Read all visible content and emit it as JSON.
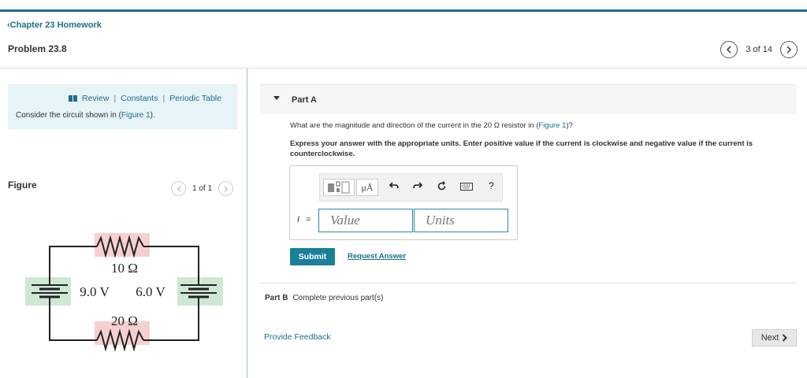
{
  "header": {
    "back_label": "Chapter 23 Homework",
    "back_chevron": "‹",
    "problem_title": "Problem 23.8",
    "pager_text": "3 of 14",
    "prev_icon": "chevron-left-icon",
    "next_icon": "chevron-right-icon"
  },
  "sidebar": {
    "links": [
      "Review",
      "Constants",
      "Periodic Table"
    ],
    "separator": "|",
    "consider_prefix": "Consider the circuit shown in (",
    "consider_link": "Figure 1",
    "consider_suffix": ").",
    "figure_label": "Figure",
    "figure_pager": "1 of 1"
  },
  "circuit": {
    "r_top": "10 Ω",
    "r_bottom": "20 Ω",
    "v_left": "9.0 V",
    "v_right": "6.0 V"
  },
  "part_a": {
    "label": "Part A",
    "question_prefix": "What are the magnitude and direction of the current in the 20 Ω resistor in (",
    "question_link": "Figure 1",
    "question_suffix": ")?",
    "instructions": "Express your answer with the appropriate units. Enter positive value if the current is clockwise and negative value if the current is counterclockwise.",
    "variable": "I",
    "equals": "=",
    "value_placeholder": "Value",
    "units_placeholder": "Units",
    "toolbar": {
      "units_button": "μÅ",
      "help": "?"
    },
    "submit_label": "Submit",
    "request_answer_label": "Request Answer"
  },
  "part_b": {
    "label": "Part B",
    "status": "Complete previous part(s)"
  },
  "footer": {
    "feedback_label": "Provide Feedback",
    "next_label": "Next"
  },
  "colors": {
    "accent": "#1b6f8a",
    "submit_bg": "#1b7f99",
    "resistor_highlight": "#f6d0d0",
    "battery_highlight": "#cfe8d3"
  }
}
